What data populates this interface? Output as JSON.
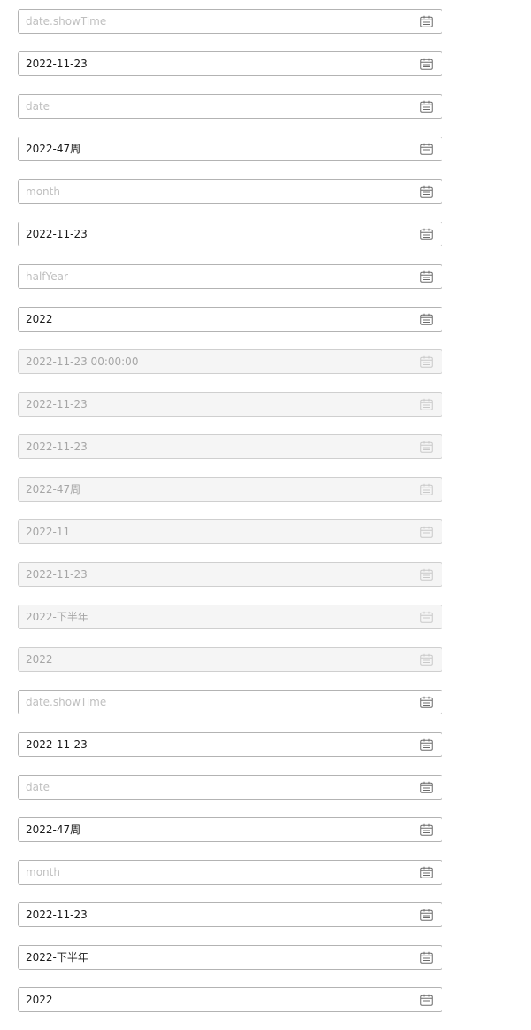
{
  "colors": {
    "border": "#b3b3b3",
    "text": "#1a1a1a",
    "placeholder": "#bfbfbf",
    "disabled_bg": "#f5f5f5",
    "disabled_text": "#a6a6a6"
  },
  "icon": "calendar-icon",
  "pickers": [
    {
      "value": "date.showTime",
      "state": "placeholder"
    },
    {
      "value": "2022-11-23",
      "state": "filled"
    },
    {
      "value": "date",
      "state": "placeholder"
    },
    {
      "value": "2022-47周",
      "state": "filled"
    },
    {
      "value": "month",
      "state": "placeholder"
    },
    {
      "value": "2022-11-23",
      "state": "filled"
    },
    {
      "value": "halfYear",
      "state": "placeholder"
    },
    {
      "value": "2022",
      "state": "filled"
    },
    {
      "value": "2022-11-23 00:00:00",
      "state": "disabled"
    },
    {
      "value": "2022-11-23",
      "state": "disabled"
    },
    {
      "value": "2022-11-23",
      "state": "disabled"
    },
    {
      "value": "2022-47周",
      "state": "disabled"
    },
    {
      "value": "2022-11",
      "state": "disabled"
    },
    {
      "value": "2022-11-23",
      "state": "disabled"
    },
    {
      "value": "2022-下半年",
      "state": "disabled"
    },
    {
      "value": "2022",
      "state": "disabled"
    },
    {
      "value": "date.showTime",
      "state": "placeholder"
    },
    {
      "value": "2022-11-23",
      "state": "filled"
    },
    {
      "value": "date",
      "state": "placeholder"
    },
    {
      "value": "2022-47周",
      "state": "filled"
    },
    {
      "value": "month",
      "state": "placeholder"
    },
    {
      "value": "2022-11-23",
      "state": "filled"
    },
    {
      "value": "2022-下半年",
      "state": "filled"
    },
    {
      "value": "2022",
      "state": "filled"
    }
  ]
}
